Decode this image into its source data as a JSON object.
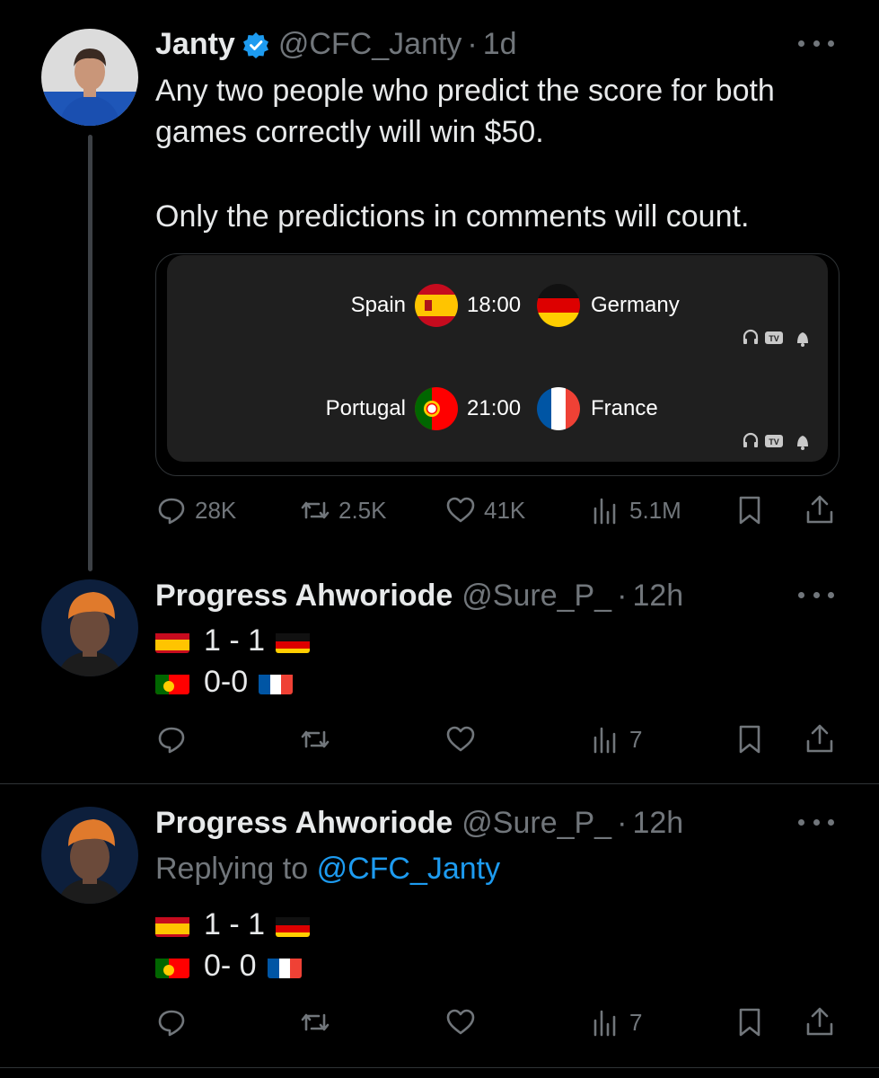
{
  "main_tweet": {
    "name": "Janty",
    "handle": "@CFC_Janty",
    "dot": "·",
    "time": "1d",
    "text_line1": "Any two people who predict the score for both",
    "text_line2": "games correctly will win $50.",
    "text_line3": "Only the predictions in comments will count.",
    "card": {
      "match1": {
        "home": "Spain",
        "time": "18:00",
        "away": "Germany"
      },
      "match2": {
        "home": "Portugal",
        "time": "21:00",
        "away": "France"
      },
      "tv_label": "TV"
    },
    "metrics": {
      "replies": "28K",
      "retweets": "2.5K",
      "likes": "41K",
      "views": "5.1M"
    }
  },
  "reply1": {
    "name": "Progress Ahworiode",
    "handle": "@Sure_P_",
    "dot": "·",
    "time": "12h",
    "line1_score": "1 - 1",
    "line2_score": "0-0",
    "views": "7"
  },
  "reply2": {
    "name": "Progress Ahworiode",
    "handle": "@Sure_P_",
    "dot": "·",
    "time": "12h",
    "replying_prefix": "Replying to",
    "replying_handle": "@CFC_Janty",
    "line1_score": "1 - 1",
    "line2_score": "0- 0",
    "views": "7"
  },
  "colors": {
    "accent": "#1d9bf0",
    "muted": "#71767b",
    "background": "#000000"
  }
}
